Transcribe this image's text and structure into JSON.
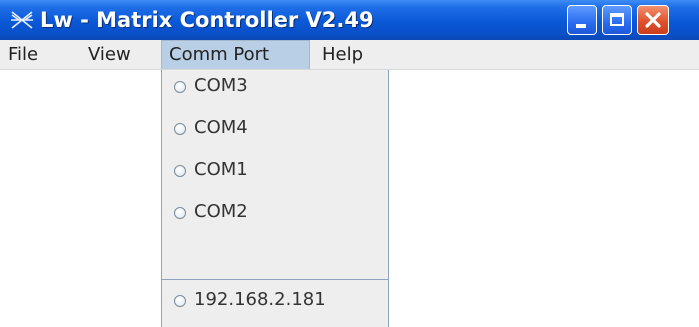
{
  "window": {
    "title": "Lw - Matrix Controller V2.49",
    "app_icon": "matrix-cross-icon",
    "controls": [
      "minimize-icon",
      "maximize-icon",
      "close-icon"
    ]
  },
  "menubar": {
    "items": [
      {
        "label": "File"
      },
      {
        "label": "View"
      },
      {
        "label": "Comm Port",
        "active": true
      },
      {
        "label": "Help"
      }
    ]
  },
  "comm_port_menu": {
    "options": [
      {
        "label": "COM3",
        "selected": false
      },
      {
        "label": "COM4",
        "selected": false
      },
      {
        "label": "COM1",
        "selected": false
      },
      {
        "label": "COM2",
        "selected": false
      },
      {
        "label": "192.168.2.181",
        "selected": false
      }
    ]
  },
  "colors": {
    "titlebar": "#0a58d6",
    "menu_highlight": "#b8cfe5",
    "close_button": "#e0522e"
  }
}
